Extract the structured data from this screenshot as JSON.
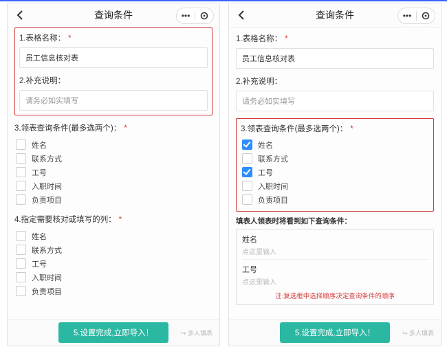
{
  "header": {
    "title": "查询条件"
  },
  "s1": {
    "label": "1.表格名称：",
    "value": "员工信息核对表"
  },
  "s2": {
    "label": "2.补充说明：",
    "placeholder": "请务必如实填写"
  },
  "s3": {
    "label": "3.领表查询条件(最多选两个)：",
    "options": [
      "姓名",
      "联系方式",
      "工号",
      "入职时间",
      "负责项目"
    ]
  },
  "s4": {
    "label": "4.指定需要核对或填写的列：",
    "options": [
      "姓名",
      "联系方式",
      "工号",
      "入职时间",
      "负责项目"
    ]
  },
  "preview": {
    "title": "填表人领表时将看到如下查询条件：",
    "field1": "姓名",
    "field2": "工号",
    "ph": "点这里输入",
    "note": "注:复选框中选择顺序决定查询条件的顺序"
  },
  "footer": {
    "submit": "5.设置完成,立即导入！",
    "note": "↪ 多人填表"
  },
  "star": "*",
  "dots": "•••"
}
